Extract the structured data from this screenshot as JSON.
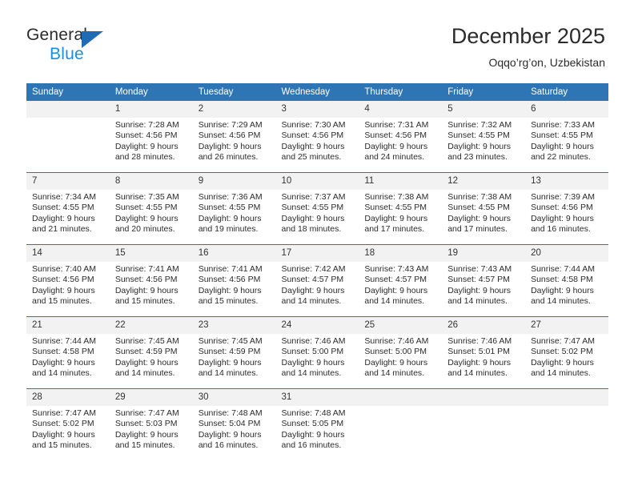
{
  "brand": {
    "name_top": "General",
    "name_bottom": "Blue",
    "triangle_icon": "triangle-icon",
    "accent_dark_blue": "#1f6cb4",
    "accent_light_blue": "#1a8fe0"
  },
  "header": {
    "title": "December 2025",
    "subtitle": "Oqqo’rg’on, Uzbekistan"
  },
  "theme": {
    "header_row_bg": "#2e75b6",
    "header_row_text": "#ffffff",
    "daynum_bg": "#f2f2f2",
    "grid_line": "#2e75b6",
    "body_text": "#2b2b2b"
  },
  "weekday_headers": [
    "Sunday",
    "Monday",
    "Tuesday",
    "Wednesday",
    "Thursday",
    "Friday",
    "Saturday"
  ],
  "weeks": [
    [
      {
        "day": "",
        "empty": true,
        "sunrise": "",
        "sunset": "",
        "daylight_line1": "",
        "daylight_line2": ""
      },
      {
        "day": "1",
        "empty": false,
        "sunrise": "Sunrise: 7:28 AM",
        "sunset": "Sunset: 4:56 PM",
        "daylight_line1": "Daylight: 9 hours",
        "daylight_line2": "and 28 minutes."
      },
      {
        "day": "2",
        "empty": false,
        "sunrise": "Sunrise: 7:29 AM",
        "sunset": "Sunset: 4:56 PM",
        "daylight_line1": "Daylight: 9 hours",
        "daylight_line2": "and 26 minutes."
      },
      {
        "day": "3",
        "empty": false,
        "sunrise": "Sunrise: 7:30 AM",
        "sunset": "Sunset: 4:56 PM",
        "daylight_line1": "Daylight: 9 hours",
        "daylight_line2": "and 25 minutes."
      },
      {
        "day": "4",
        "empty": false,
        "sunrise": "Sunrise: 7:31 AM",
        "sunset": "Sunset: 4:56 PM",
        "daylight_line1": "Daylight: 9 hours",
        "daylight_line2": "and 24 minutes."
      },
      {
        "day": "5",
        "empty": false,
        "sunrise": "Sunrise: 7:32 AM",
        "sunset": "Sunset: 4:55 PM",
        "daylight_line1": "Daylight: 9 hours",
        "daylight_line2": "and 23 minutes."
      },
      {
        "day": "6",
        "empty": false,
        "sunrise": "Sunrise: 7:33 AM",
        "sunset": "Sunset: 4:55 PM",
        "daylight_line1": "Daylight: 9 hours",
        "daylight_line2": "and 22 minutes."
      }
    ],
    [
      {
        "day": "7",
        "empty": false,
        "sunrise": "Sunrise: 7:34 AM",
        "sunset": "Sunset: 4:55 PM",
        "daylight_line1": "Daylight: 9 hours",
        "daylight_line2": "and 21 minutes."
      },
      {
        "day": "8",
        "empty": false,
        "sunrise": "Sunrise: 7:35 AM",
        "sunset": "Sunset: 4:55 PM",
        "daylight_line1": "Daylight: 9 hours",
        "daylight_line2": "and 20 minutes."
      },
      {
        "day": "9",
        "empty": false,
        "sunrise": "Sunrise: 7:36 AM",
        "sunset": "Sunset: 4:55 PM",
        "daylight_line1": "Daylight: 9 hours",
        "daylight_line2": "and 19 minutes."
      },
      {
        "day": "10",
        "empty": false,
        "sunrise": "Sunrise: 7:37 AM",
        "sunset": "Sunset: 4:55 PM",
        "daylight_line1": "Daylight: 9 hours",
        "daylight_line2": "and 18 minutes."
      },
      {
        "day": "11",
        "empty": false,
        "sunrise": "Sunrise: 7:38 AM",
        "sunset": "Sunset: 4:55 PM",
        "daylight_line1": "Daylight: 9 hours",
        "daylight_line2": "and 17 minutes."
      },
      {
        "day": "12",
        "empty": false,
        "sunrise": "Sunrise: 7:38 AM",
        "sunset": "Sunset: 4:55 PM",
        "daylight_line1": "Daylight: 9 hours",
        "daylight_line2": "and 17 minutes."
      },
      {
        "day": "13",
        "empty": false,
        "sunrise": "Sunrise: 7:39 AM",
        "sunset": "Sunset: 4:56 PM",
        "daylight_line1": "Daylight: 9 hours",
        "daylight_line2": "and 16 minutes."
      }
    ],
    [
      {
        "day": "14",
        "empty": false,
        "sunrise": "Sunrise: 7:40 AM",
        "sunset": "Sunset: 4:56 PM",
        "daylight_line1": "Daylight: 9 hours",
        "daylight_line2": "and 15 minutes."
      },
      {
        "day": "15",
        "empty": false,
        "sunrise": "Sunrise: 7:41 AM",
        "sunset": "Sunset: 4:56 PM",
        "daylight_line1": "Daylight: 9 hours",
        "daylight_line2": "and 15 minutes."
      },
      {
        "day": "16",
        "empty": false,
        "sunrise": "Sunrise: 7:41 AM",
        "sunset": "Sunset: 4:56 PM",
        "daylight_line1": "Daylight: 9 hours",
        "daylight_line2": "and 15 minutes."
      },
      {
        "day": "17",
        "empty": false,
        "sunrise": "Sunrise: 7:42 AM",
        "sunset": "Sunset: 4:57 PM",
        "daylight_line1": "Daylight: 9 hours",
        "daylight_line2": "and 14 minutes."
      },
      {
        "day": "18",
        "empty": false,
        "sunrise": "Sunrise: 7:43 AM",
        "sunset": "Sunset: 4:57 PM",
        "daylight_line1": "Daylight: 9 hours",
        "daylight_line2": "and 14 minutes."
      },
      {
        "day": "19",
        "empty": false,
        "sunrise": "Sunrise: 7:43 AM",
        "sunset": "Sunset: 4:57 PM",
        "daylight_line1": "Daylight: 9 hours",
        "daylight_line2": "and 14 minutes."
      },
      {
        "day": "20",
        "empty": false,
        "sunrise": "Sunrise: 7:44 AM",
        "sunset": "Sunset: 4:58 PM",
        "daylight_line1": "Daylight: 9 hours",
        "daylight_line2": "and 14 minutes."
      }
    ],
    [
      {
        "day": "21",
        "empty": false,
        "sunrise": "Sunrise: 7:44 AM",
        "sunset": "Sunset: 4:58 PM",
        "daylight_line1": "Daylight: 9 hours",
        "daylight_line2": "and 14 minutes."
      },
      {
        "day": "22",
        "empty": false,
        "sunrise": "Sunrise: 7:45 AM",
        "sunset": "Sunset: 4:59 PM",
        "daylight_line1": "Daylight: 9 hours",
        "daylight_line2": "and 14 minutes."
      },
      {
        "day": "23",
        "empty": false,
        "sunrise": "Sunrise: 7:45 AM",
        "sunset": "Sunset: 4:59 PM",
        "daylight_line1": "Daylight: 9 hours",
        "daylight_line2": "and 14 minutes."
      },
      {
        "day": "24",
        "empty": false,
        "sunrise": "Sunrise: 7:46 AM",
        "sunset": "Sunset: 5:00 PM",
        "daylight_line1": "Daylight: 9 hours",
        "daylight_line2": "and 14 minutes."
      },
      {
        "day": "25",
        "empty": false,
        "sunrise": "Sunrise: 7:46 AM",
        "sunset": "Sunset: 5:00 PM",
        "daylight_line1": "Daylight: 9 hours",
        "daylight_line2": "and 14 minutes."
      },
      {
        "day": "26",
        "empty": false,
        "sunrise": "Sunrise: 7:46 AM",
        "sunset": "Sunset: 5:01 PM",
        "daylight_line1": "Daylight: 9 hours",
        "daylight_line2": "and 14 minutes."
      },
      {
        "day": "27",
        "empty": false,
        "sunrise": "Sunrise: 7:47 AM",
        "sunset": "Sunset: 5:02 PM",
        "daylight_line1": "Daylight: 9 hours",
        "daylight_line2": "and 14 minutes."
      }
    ],
    [
      {
        "day": "28",
        "empty": false,
        "sunrise": "Sunrise: 7:47 AM",
        "sunset": "Sunset: 5:02 PM",
        "daylight_line1": "Daylight: 9 hours",
        "daylight_line2": "and 15 minutes."
      },
      {
        "day": "29",
        "empty": false,
        "sunrise": "Sunrise: 7:47 AM",
        "sunset": "Sunset: 5:03 PM",
        "daylight_line1": "Daylight: 9 hours",
        "daylight_line2": "and 15 minutes."
      },
      {
        "day": "30",
        "empty": false,
        "sunrise": "Sunrise: 7:48 AM",
        "sunset": "Sunset: 5:04 PM",
        "daylight_line1": "Daylight: 9 hours",
        "daylight_line2": "and 16 minutes."
      },
      {
        "day": "31",
        "empty": false,
        "sunrise": "Sunrise: 7:48 AM",
        "sunset": "Sunset: 5:05 PM",
        "daylight_line1": "Daylight: 9 hours",
        "daylight_line2": "and 16 minutes."
      },
      {
        "day": "",
        "empty": true,
        "sunrise": "",
        "sunset": "",
        "daylight_line1": "",
        "daylight_line2": ""
      },
      {
        "day": "",
        "empty": true,
        "sunrise": "",
        "sunset": "",
        "daylight_line1": "",
        "daylight_line2": ""
      },
      {
        "day": "",
        "empty": true,
        "sunrise": "",
        "sunset": "",
        "daylight_line1": "",
        "daylight_line2": ""
      }
    ]
  ]
}
